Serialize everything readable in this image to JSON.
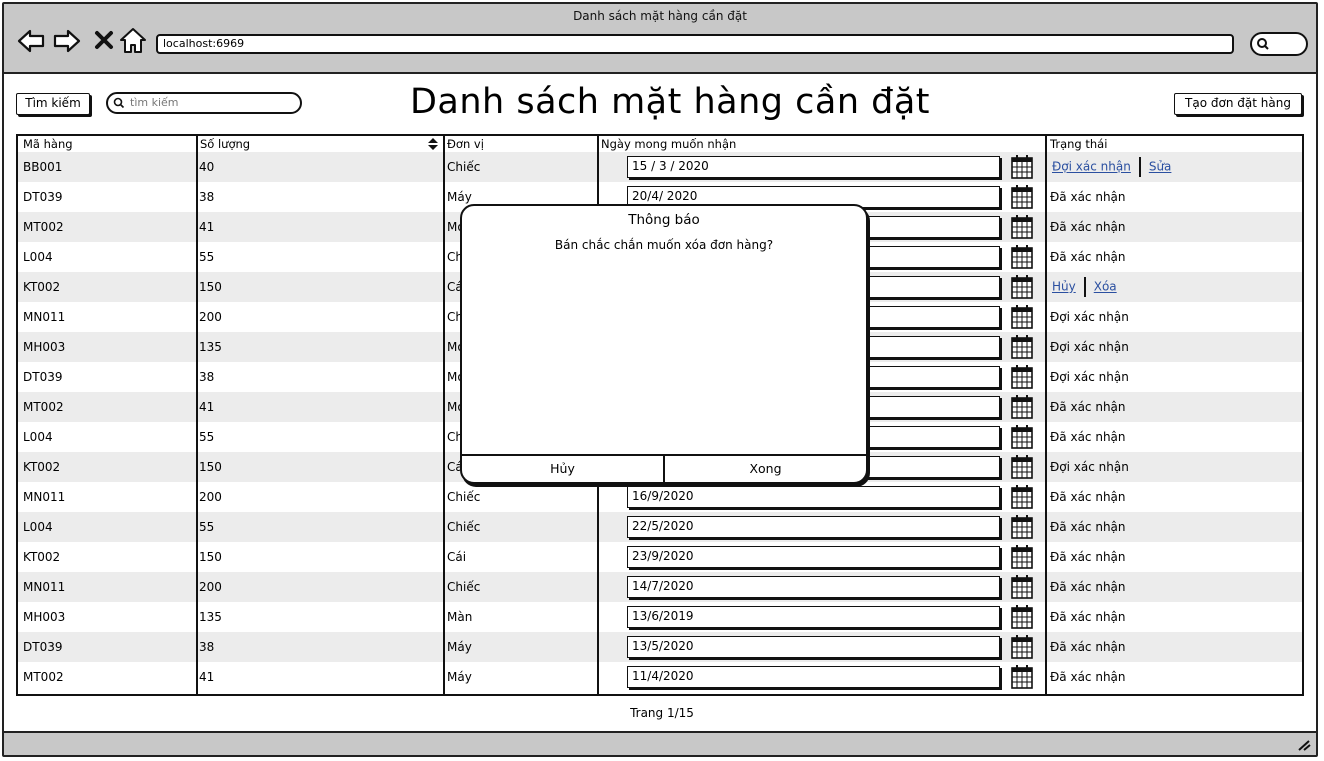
{
  "window": {
    "title": "Danh sách mặt hàng cần đặt",
    "url": "localhost:6969"
  },
  "toolbar": {
    "search_button": "Tìm kiếm",
    "search_placeholder": "tìm kiếm",
    "page_title": "Danh sách mặt hàng cần đặt",
    "create_button": "Tạo đơn đặt hàng"
  },
  "table": {
    "headers": {
      "code": "Mã hàng",
      "quantity": "Số lượng",
      "unit": "Đơn vị",
      "date": "Ngày mong muốn nhận",
      "status": "Trạng thái"
    },
    "rows": [
      {
        "code": "BB001",
        "quantity": "40",
        "unit": "Chiếc",
        "date": "15 / 3 / 2020",
        "status": "",
        "actions": [
          "Đợi xác nhận",
          "Sửa"
        ]
      },
      {
        "code": "DT039",
        "quantity": "38",
        "unit": "Máy",
        "date": "20/4/ 2020",
        "status": "Đã xác nhận"
      },
      {
        "code": "MT002",
        "quantity": "41",
        "unit": "Mó",
        "date": "",
        "status": "Đã xác nhận"
      },
      {
        "code": "L004",
        "quantity": "55",
        "unit": "Ch",
        "date": "",
        "status": "Đã xác nhận"
      },
      {
        "code": "KT002",
        "quantity": "150",
        "unit": "Cá",
        "date": "",
        "status": "",
        "actions": [
          "Hủy",
          "Xóa"
        ]
      },
      {
        "code": "MN011",
        "quantity": "200",
        "unit": "Ch",
        "date": "",
        "status": "Đợi xác nhận"
      },
      {
        "code": "MH003",
        "quantity": "135",
        "unit": "Mó",
        "date": "",
        "status": "Đợi xác nhận"
      },
      {
        "code": "DT039",
        "quantity": "38",
        "unit": "Mó",
        "date": "",
        "status": "Đợi xác nhận"
      },
      {
        "code": "MT002",
        "quantity": "41",
        "unit": "Mó",
        "date": "",
        "status": "Đã xác nhận"
      },
      {
        "code": "L004",
        "quantity": "55",
        "unit": "Ch",
        "date": "",
        "status": "Đã xác nhận"
      },
      {
        "code": "KT002",
        "quantity": "150",
        "unit": "Cá",
        "date": "",
        "status": "Đợi xác nhận"
      },
      {
        "code": "MN011",
        "quantity": "200",
        "unit": "Chiếc",
        "date": "16/9/2020",
        "status": "Đã xác nhận"
      },
      {
        "code": "L004",
        "quantity": "55",
        "unit": "Chiếc",
        "date": "22/5/2020",
        "status": "Đã xác nhận"
      },
      {
        "code": "KT002",
        "quantity": "150",
        "unit": "Cái",
        "date": "23/9/2020",
        "status": "Đã xác nhận"
      },
      {
        "code": "MN011",
        "quantity": "200",
        "unit": "Chiếc",
        "date": "14/7/2020",
        "status": "Đã xác nhận"
      },
      {
        "code": "MH003",
        "quantity": "135",
        "unit": "Màn",
        "date": "13/6/2019",
        "status": "Đã xác nhận"
      },
      {
        "code": "DT039",
        "quantity": "38",
        "unit": "Máy",
        "date": "13/5/2020",
        "status": "Đã xác nhận"
      },
      {
        "code": "MT002",
        "quantity": "41",
        "unit": "Máy",
        "date": "11/4/2020",
        "status": "Đã xác nhận"
      }
    ]
  },
  "modal": {
    "title": "Thông báo",
    "message": "Bán chắc chắn muốn xóa đơn hàng?",
    "cancel": "Hủy",
    "confirm": "Xong"
  },
  "pager": {
    "label": "Trang 1/15"
  }
}
